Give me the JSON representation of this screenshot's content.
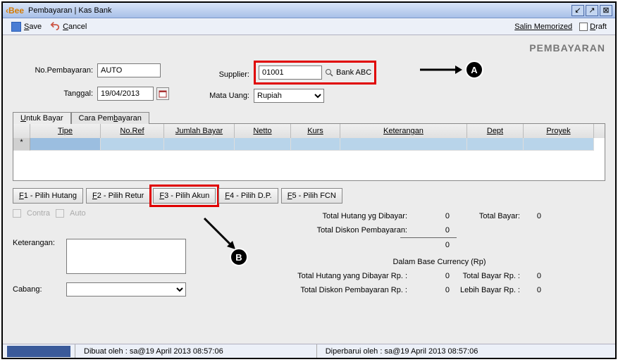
{
  "titlebar": {
    "logo": "Bee",
    "title": "Pembayaran | Kas Bank"
  },
  "toolbar": {
    "save_label": "Save",
    "cancel_label": "Cancel",
    "salin_label": "Salin Memorized",
    "draft_label": "Draft"
  },
  "page_title": "PEMBAYARAN",
  "form": {
    "no_pembayaran_label": "No.Pembayaran:",
    "no_pembayaran_value": "AUTO",
    "tanggal_label": "Tanggal:",
    "tanggal_value": "19/04/2013",
    "supplier_label": "Supplier:",
    "supplier_value": "01001",
    "supplier_name": "Bank ABC",
    "matauang_label": "Mata Uang:",
    "matauang_value": "Rupiah"
  },
  "tabs": {
    "tab1": "Untuk Bayar",
    "tab2": "Cara Pembayaran"
  },
  "grid": {
    "headers": [
      "",
      "Tipe",
      "No.Ref",
      "Jumlah Bayar",
      "Netto",
      "Kurs",
      "Keterangan",
      "Dept",
      "Proyek"
    ],
    "row_marker": "*"
  },
  "fn": {
    "f1": "F1 - Pilih Hutang",
    "f2": "F2 - Pilih Retur",
    "f3": "F3 - Pilih Akun",
    "f4": "F4 - Pilih D.P.",
    "f5": "F5 - Pilih FCN"
  },
  "checks": {
    "contra": "Contra",
    "auto": "Auto"
  },
  "keterangan_label": "Keterangan:",
  "cabang_label": "Cabang:",
  "totals": {
    "hutang_dibayar_label": "Total Hutang yg Dibayar:",
    "hutang_dibayar_value": "0",
    "total_bayar_label": "Total Bayar:",
    "total_bayar_value": "0",
    "diskon_label": "Total Diskon Pembayaran:",
    "diskon_value": "0",
    "subtotal_value": "0",
    "base_title": "Dalam Base Currency (Rp)",
    "hutang_rp_label": "Total Hutang yang Dibayar Rp. :",
    "hutang_rp_value": "0",
    "total_bayar_rp_label": "Total Bayar Rp. :",
    "total_bayar_rp_value": "0",
    "diskon_rp_label": "Total Diskon Pembayaran Rp. :",
    "diskon_rp_value": "0",
    "lebih_bayar_label": "Lebih Bayar Rp. :",
    "lebih_bayar_value": "0"
  },
  "status": {
    "created": "Dibuat oleh : sa@19 April 2013  08:57:06",
    "updated": "Diperbarui oleh : sa@19 April 2013  08:57:06"
  },
  "callouts": {
    "a": "A",
    "b": "B"
  }
}
